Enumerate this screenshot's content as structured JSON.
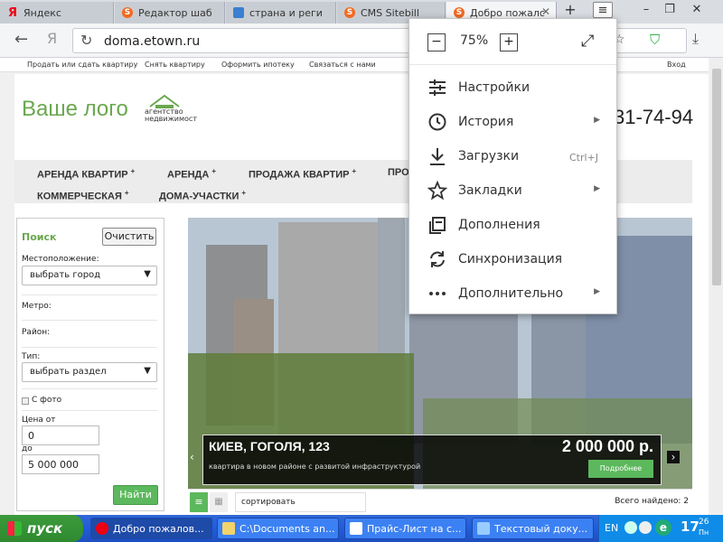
{
  "tabs": [
    {
      "title": "Яндекс"
    },
    {
      "title": "Редактор шаб"
    },
    {
      "title": "страна и реги"
    },
    {
      "title": "CMS Sitebill"
    },
    {
      "title": "Добро пожалс"
    }
  ],
  "address": {
    "url": "doma.etown.ru"
  },
  "site": {
    "topnav": [
      "Продать или сдать квартиру",
      "Снять квартиру",
      "Оформить ипотеку",
      "Связаться с нами",
      "Вход"
    ],
    "logo": "Ваше лого",
    "logo_sub1": "агентство",
    "logo_sub2": "недвижимост",
    "phone": "31-74-94",
    "menu": [
      "АРЕНДА КВАРТИР",
      "АРЕНДА",
      "ПРОДАЖА КВАРТИР",
      "ПРО",
      "КОММЕРЧЕСКАЯ",
      "ДОМА-УЧАСТКИ"
    ],
    "search": {
      "title": "Поиск",
      "clear_label": "Очистить",
      "location_label": "Местоположение:",
      "city_value": "выбрать город",
      "metro_label": "Метро:",
      "district_label": "Район:",
      "type_label": "Тип:",
      "type_value": "выбрать раздел",
      "photo_label": "С фото",
      "price_from_label": "Цена от",
      "price_from_value": "0",
      "price_to_label": "до",
      "price_to_value": "5 000 000",
      "find_label": "Найти"
    },
    "listing": {
      "title": "КИЕВ, ГОГОЛЯ, 123",
      "price": "2 000 000 р.",
      "description": "квартира в новом районе с развитой инфраструктурой",
      "more_label": "Подробнее"
    },
    "sort_label": "сортировать",
    "found_label": "Всего найдено: 2"
  },
  "browser_menu": {
    "zoom": "75%",
    "items": [
      {
        "label": "Настройки",
        "icon": "settings-sliders-icon"
      },
      {
        "label": "История",
        "icon": "history-clock-icon",
        "submenu": true
      },
      {
        "label": "Загрузки",
        "icon": "download-icon",
        "shortcut": "Ctrl+J"
      },
      {
        "label": "Закладки",
        "icon": "bookmark-star-icon",
        "submenu": true
      },
      {
        "label": "Дополнения",
        "icon": "addons-icon"
      },
      {
        "label": "Синхронизация",
        "icon": "sync-icon"
      },
      {
        "label": "Дополнительно",
        "icon": "more-dots-icon",
        "submenu": true
      }
    ]
  },
  "taskbar": {
    "start": "пуск",
    "items": [
      "Добро пожалов...",
      "C:\\Documents an...",
      "Прайс-Лист на с...",
      "Текстовый доку..."
    ],
    "lang": "EN",
    "time_h": "17",
    "time_m": "26",
    "day": "Пн"
  },
  "colors": {
    "logo_green": "#6aa84f",
    "button_green": "#5cb85c",
    "accent_blue": "#3a7fd0",
    "yandex_red": "#e01"
  }
}
